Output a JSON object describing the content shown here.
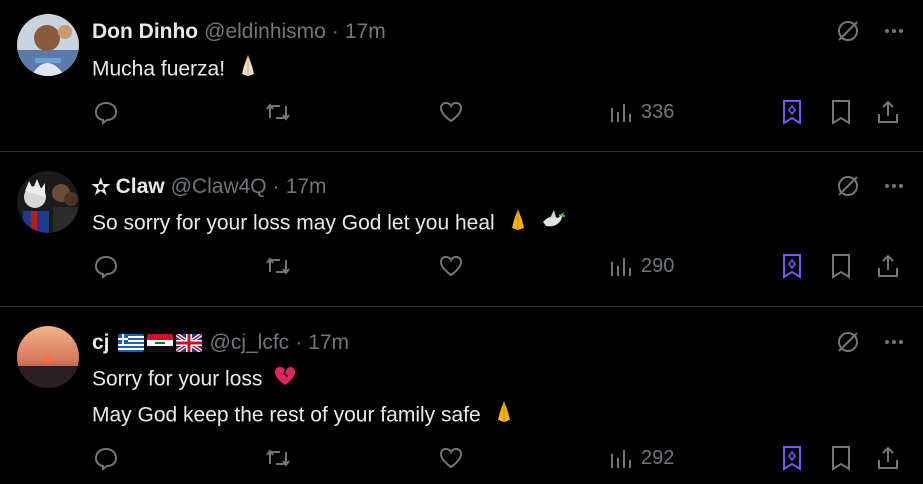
{
  "tweets": [
    {
      "name": "Don Dinho",
      "handle": "@eldinhismo",
      "separator": "·",
      "time": "17m",
      "text_lines": [
        "Mucha fuerza!"
      ],
      "views": "336"
    },
    {
      "star_prefix": "✫",
      "name": "Claw",
      "handle": "@Claw4Q",
      "separator": "·",
      "time": "17m",
      "text_lines": [
        "So sorry for your loss may God let you heal"
      ],
      "views": "290"
    },
    {
      "name": "cj",
      "handle": "@cj_lcfc",
      "separator": "·",
      "time": "17m",
      "text_lines": [
        "Sorry for your loss",
        "May God keep the rest of your family safe"
      ],
      "views": "292"
    }
  ],
  "icons": {
    "grok": "grok-icon",
    "more": "more-icon",
    "reply": "reply-icon",
    "repost": "repost-icon",
    "like": "like-icon",
    "views": "views-icon",
    "bookmark_grok": "grok-bookmark-icon",
    "bookmark": "bookmark-icon",
    "share": "share-icon"
  },
  "colors": {
    "background": "#000000",
    "text": "#e7e9ea",
    "muted": "#71767b",
    "accent": "#7856ff",
    "divider": "#2f3336"
  }
}
